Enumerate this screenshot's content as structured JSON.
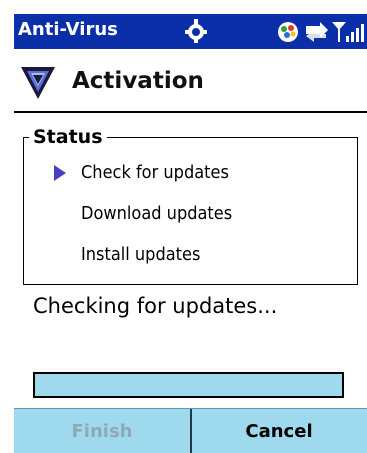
{
  "titlebar": {
    "app_title": "Anti-Virus",
    "icons": [
      "sync-icon",
      "messenger-icon",
      "data-connection-icon",
      "signal-strength-icon"
    ]
  },
  "header": {
    "title": "Activation",
    "logo_icon": "shield-v-logo"
  },
  "status": {
    "legend": "Status",
    "steps": [
      {
        "label": "Check for updates",
        "current": true
      },
      {
        "label": "Download updates",
        "current": false
      },
      {
        "label": "Install updates",
        "current": false
      }
    ]
  },
  "progress": {
    "text": "Checking for updates...",
    "fraction": 0
  },
  "softkeys": {
    "left_label": "Finish",
    "left_enabled": false,
    "right_label": "Cancel"
  },
  "colors": {
    "titlebar": "#0a2fa8",
    "softkey_bar": "#9fd9ee",
    "arrow": "#4b3ec0"
  }
}
